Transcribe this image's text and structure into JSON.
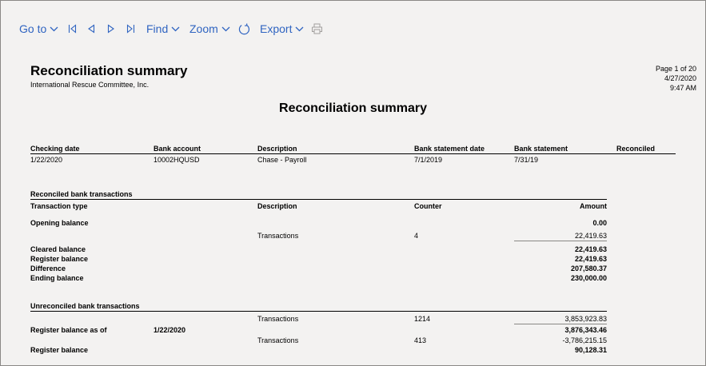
{
  "toolbar": {
    "goto": "Go to",
    "find": "Find",
    "zoom": "Zoom",
    "export": "Export"
  },
  "report": {
    "title": "Reconciliation summary",
    "company": "International Rescue Committee, Inc.",
    "page": "Page 1 of 20",
    "date": "4/27/2020",
    "time": "9:47 AM",
    "heading": "Reconciliation summary"
  },
  "header_table": {
    "columns": [
      "Checking date",
      "Bank account",
      "Description",
      "Bank statement date",
      "Bank statement",
      "Reconciled"
    ],
    "row": [
      "1/22/2020",
      "10002HQUSD",
      "Chase - Payroll",
      "7/1/2019",
      "7/31/19",
      ""
    ]
  },
  "reconciled": {
    "section_title": "Reconciled bank transactions",
    "columns": {
      "type": "Transaction type",
      "description": "Description",
      "counter": "Counter",
      "amount": "Amount"
    },
    "opening_label": "Opening balance",
    "opening_amount": "0.00",
    "tx_description": "Transactions",
    "tx_counter": "4",
    "tx_amount": "22,419.63",
    "summary": [
      {
        "label": "Cleared balance",
        "amount": "22,419.63"
      },
      {
        "label": "Register balance",
        "amount": "22,419.63"
      },
      {
        "label": "Difference",
        "amount": "207,580.37"
      },
      {
        "label": "Ending balance",
        "amount": "230,000.00"
      }
    ]
  },
  "unreconciled": {
    "section_title": "Unreconciled bank transactions",
    "tx1_description": "Transactions",
    "tx1_counter": "1214",
    "tx1_amount": "3,853,923.83",
    "register_asof_label": "Register balance as of",
    "register_asof_date": "1/22/2020",
    "register_asof_amount": "3,876,343.46",
    "tx2_description": "Transactions",
    "tx2_counter": "413",
    "tx2_amount": "-3,786,215.15",
    "register_label": "Register balance",
    "register_amount": "90,128.31"
  }
}
